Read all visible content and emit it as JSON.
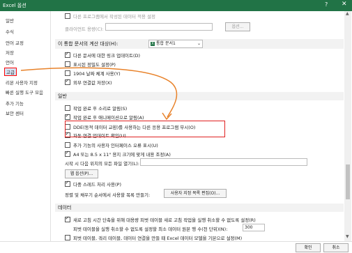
{
  "window": {
    "title": "Excel 옵션",
    "help": "?",
    "close": "✕"
  },
  "nav": {
    "items": [
      "일반",
      "수식",
      "언어 교정",
      "저장",
      "언어",
      "고급",
      "리본 사용자 지정",
      "빠른 실행 도구 모음",
      "추가 기능",
      "보안 센터"
    ],
    "selected": "고급"
  },
  "top_faded": {
    "row1": "다른 프로그램에서 작성된 데이터 적용 설정",
    "row2_label": "클라이언트 용량(C):",
    "row2_button": "옵션..."
  },
  "calc_section": {
    "label": "이 통합 문서의 계산 대상(H):",
    "workbook_value": "통합 문서1",
    "options": [
      {
        "label": "다른 문서에 대한 링크 업데이트(D)",
        "checked": true
      },
      {
        "label": "표시된 정밀도 설정(P)",
        "checked": false
      },
      {
        "label": "1904 날짜 체계 사용(Y)",
        "checked": false
      },
      {
        "label": "외부 연결값 저장(X)",
        "checked": true
      }
    ]
  },
  "general_section": {
    "header": "일반",
    "options": [
      {
        "label": "작업 완료 후 소리로 알림(S)",
        "checked": false
      },
      {
        "label": "작업 완료 후 애니메이션으로 알림(A)",
        "checked": true
      },
      {
        "label": "DDE(동적 데이터 교환)를 사용하는 다른 응용 프로그램 무시(O)",
        "checked": false
      },
      {
        "label": "자동 연결 업데이트 확인(U)",
        "checked": true
      },
      {
        "label": "추가 기능의 사용자 인터페이스 오류 표시(U)",
        "checked": false
      },
      {
        "label": "A4 또는 8.5 x 11\" 용지 크기에 맞게 내용 조정(A)",
        "checked": true
      }
    ],
    "startup_label": "시작 시 다음 위치의 모든 파일 열기(L):",
    "web_options": "웹 옵션(P)...",
    "multithread": {
      "label": "다중 스레드 처리 사용(P)",
      "checked": true
    },
    "sort_label": "정렬 및 채우기 순서에서 사용할 목록 만들기:",
    "custom_list_button": "사용자 지정 목록 편집(O)..."
  },
  "data_section": {
    "header": "데이터",
    "opt1": {
      "label": "새로 고침 시간 단축을 위해 대용량 피벗 테이블 새로 고침 작업을 실행 취소할 수 없도록 설정(R)",
      "checked": true
    },
    "row2_label": "피벗 테이블을 실행 취소할 수 없도록 설정할 최소 데이터 원본 행 수(천 단위)(N):",
    "row2_value": "300",
    "opt3": {
      "label": "피벗 테이블, 쿼리 테이블, 데이터 연결을 만들 때 Excel 데이터 모델을 기본으로 설정(M)",
      "checked": false
    }
  },
  "footer": {
    "ok": "확인",
    "cancel": "취소"
  },
  "colors": {
    "titlebar": "#217346",
    "highlight": "#e02020",
    "arrow": "#e8822a"
  }
}
